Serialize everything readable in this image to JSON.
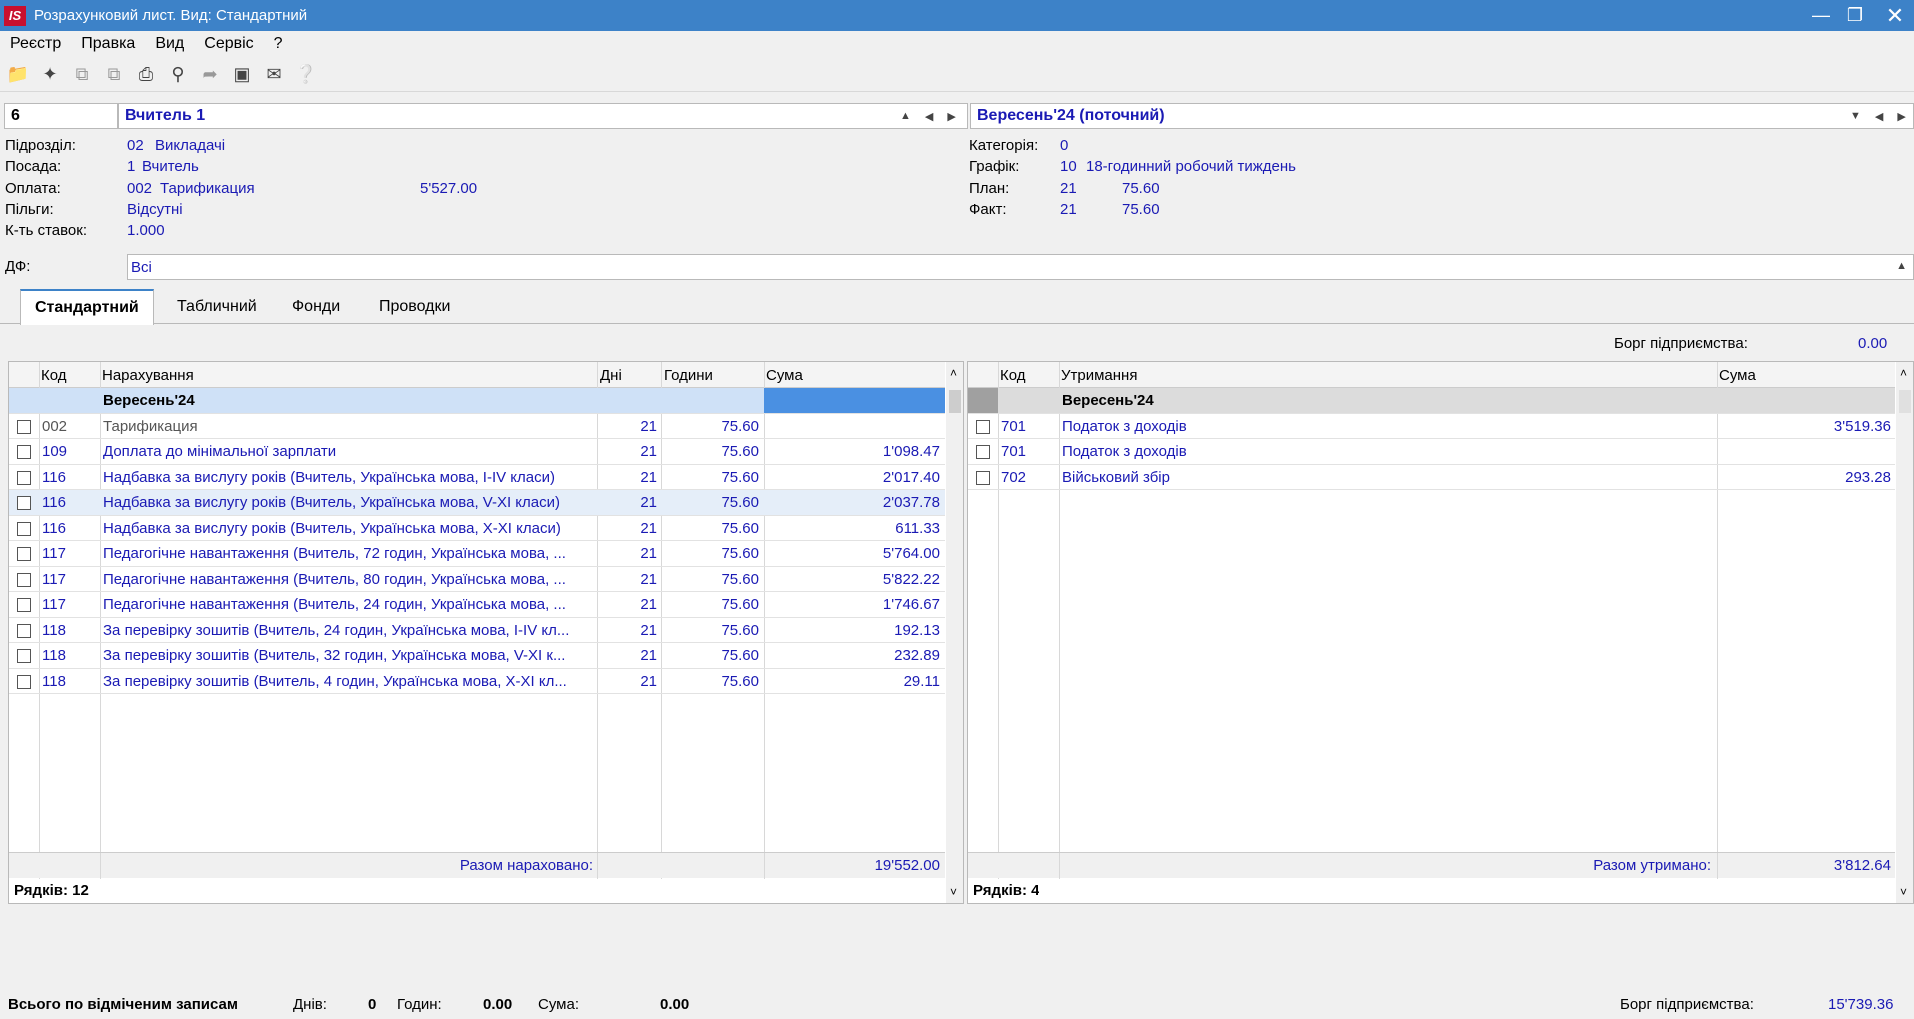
{
  "window": {
    "title": "Розрахунковий лист. Вид: Стандартний",
    "logo": "IS"
  },
  "menu": [
    "Реєстр",
    "Правка",
    "Вид",
    "Сервіс",
    "?"
  ],
  "header": {
    "employee_code": "6",
    "employee_name": "Вчитель 1",
    "period": "Вересень'24 (поточний)"
  },
  "info_left": {
    "division_label": "Підрозділ:",
    "division_code": "02",
    "division_name": "Викладачі",
    "position_label": "Посада:",
    "position_code": "1",
    "position_name": "Вчитель",
    "payment_label": "Оплата:",
    "payment_code": "002",
    "payment_name": "Тарификация",
    "payment_amount": "5'527.00",
    "benefits_label": "Пільги:",
    "benefits_value": "Відсутні",
    "rate_label": "К-ть ставок:",
    "rate_value": "1.000"
  },
  "info_right": {
    "category_label": "Категорія:",
    "category_value": "0",
    "schedule_label": "Графік:",
    "schedule_code": "10",
    "schedule_name": "18-годинний робочий тиждень",
    "plan_label": "План:",
    "plan_days": "21",
    "plan_hours": "75.60",
    "fact_label": "Факт:",
    "fact_days": "21",
    "fact_hours": "75.60"
  },
  "df": {
    "label": "ДФ:",
    "value": "Всі"
  },
  "tabs": [
    "Стандартний",
    "Табличний",
    "Фонди",
    "Проводки"
  ],
  "debt_top": {
    "label": "Борг підприємства:",
    "value": "0.00"
  },
  "accruals": {
    "headers": {
      "code": "Код",
      "name": "Нарахування",
      "days": "Дні",
      "hours": "Години",
      "sum": "Сума"
    },
    "group": "Вересень'24",
    "rows": [
      {
        "code": "002",
        "name": "Тарификация",
        "days": "21",
        "hours": "75.60",
        "sum": ""
      },
      {
        "code": "109",
        "name": "Доплата до мінімальної зарплати",
        "days": "21",
        "hours": "75.60",
        "sum": "1'098.47"
      },
      {
        "code": "116",
        "name": "Надбавка за вислугу років (Вчитель, Українська мова, I-IV класи)",
        "days": "21",
        "hours": "75.60",
        "sum": "2'017.40"
      },
      {
        "code": "116",
        "name": "Надбавка за вислугу років (Вчитель, Українська мова, V-XI класи)",
        "days": "21",
        "hours": "75.60",
        "sum": "2'037.78"
      },
      {
        "code": "116",
        "name": "Надбавка за вислугу років (Вчитель, Українська мова, X-XI класи)",
        "days": "21",
        "hours": "75.60",
        "sum": "611.33"
      },
      {
        "code": "117",
        "name": "Педагогічне навантаження (Вчитель, 72 годин, Українська мова, ...",
        "days": "21",
        "hours": "75.60",
        "sum": "5'764.00"
      },
      {
        "code": "117",
        "name": "Педагогічне навантаження (Вчитель, 80 годин, Українська мова, ...",
        "days": "21",
        "hours": "75.60",
        "sum": "5'822.22"
      },
      {
        "code": "117",
        "name": "Педагогічне навантаження (Вчитель, 24 годин, Українська мова, ...",
        "days": "21",
        "hours": "75.60",
        "sum": "1'746.67"
      },
      {
        "code": "118",
        "name": "За перевірку зошитів (Вчитель, 24 годин, Українська мова, I-IV кл...",
        "days": "21",
        "hours": "75.60",
        "sum": "192.13"
      },
      {
        "code": "118",
        "name": "За перевірку зошитів (Вчитель, 32 годин, Українська мова, V-XI к...",
        "days": "21",
        "hours": "75.60",
        "sum": "232.89"
      },
      {
        "code": "118",
        "name": "За перевірку зошитів (Вчитель, 4 годин, Українська мова, X-XI кл...",
        "days": "21",
        "hours": "75.60",
        "sum": "29.11"
      }
    ],
    "total_label": "Разом нараховано:",
    "total_value": "19'552.00",
    "rows_count": "Рядків: 12"
  },
  "deductions": {
    "headers": {
      "code": "Код",
      "name": "Утримання",
      "sum": "Сума"
    },
    "group": "Вересень'24",
    "rows": [
      {
        "code": "701",
        "name": "Податок з доходів",
        "sum": "3'519.36"
      },
      {
        "code": "701",
        "name": "Податок з доходів",
        "sum": ""
      },
      {
        "code": "702",
        "name": "Військовий збір",
        "sum": "293.28"
      }
    ],
    "total_label": "Разом утримано:",
    "total_value": "3'812.64",
    "rows_count": "Рядків: 4"
  },
  "status": {
    "marked_label": "Всього по відміченим записам",
    "days_label": "Днів:",
    "days_value": "0",
    "hours_label": "Годин:",
    "hours_value": "0.00",
    "sum_label": "Сума:",
    "sum_value": "0.00",
    "debt_label": "Борг підприємства:",
    "debt_value": "15'739.36"
  }
}
